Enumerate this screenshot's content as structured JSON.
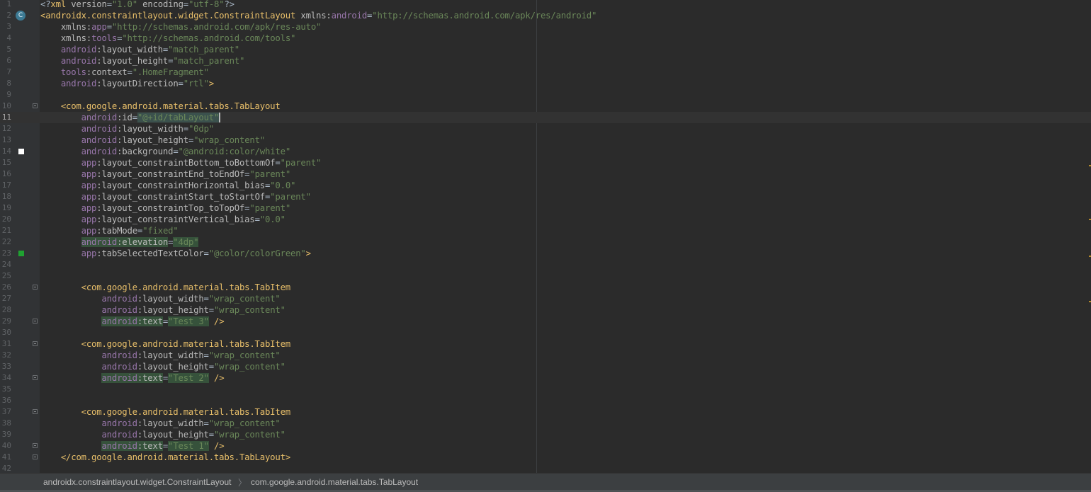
{
  "editor": {
    "current_line": 11,
    "lines": [
      {
        "n": "1",
        "tokens": [
          [
            "t",
            "<?"
          ],
          [
            "tag",
            "xml "
          ],
          [
            "attr",
            "version"
          ],
          [
            "t",
            "="
          ],
          [
            "val",
            "\"1.0\""
          ],
          [
            "t",
            " "
          ],
          [
            "attr",
            "encoding"
          ],
          [
            "t",
            "="
          ],
          [
            "val",
            "\"utf-8\""
          ],
          [
            "t",
            "?>"
          ]
        ]
      },
      {
        "n": "2",
        "marker": "class-icon",
        "marker_label": "C",
        "tokens": [
          [
            "tag",
            "<androidx.constraintlayout.widget.ConstraintLayout "
          ],
          [
            "attr",
            "xmlns:"
          ],
          [
            "ns",
            "android"
          ],
          [
            "t",
            "="
          ],
          [
            "val",
            "\"http://schemas.android.com/apk/res/android\""
          ]
        ]
      },
      {
        "n": "3",
        "tokens": [
          [
            "t",
            "    "
          ],
          [
            "attr",
            "xmlns:"
          ],
          [
            "ns",
            "app"
          ],
          [
            "t",
            "="
          ],
          [
            "val",
            "\"http://schemas.android.com/apk/res-auto\""
          ]
        ]
      },
      {
        "n": "4",
        "tokens": [
          [
            "t",
            "    "
          ],
          [
            "attr",
            "xmlns:"
          ],
          [
            "ns",
            "tools"
          ],
          [
            "t",
            "="
          ],
          [
            "val",
            "\"http://schemas.android.com/tools\""
          ]
        ]
      },
      {
        "n": "5",
        "tokens": [
          [
            "t",
            "    "
          ],
          [
            "ns",
            "android"
          ],
          [
            "attr",
            ":layout_width"
          ],
          [
            "t",
            "="
          ],
          [
            "val",
            "\"match_parent\""
          ]
        ]
      },
      {
        "n": "6",
        "tokens": [
          [
            "t",
            "    "
          ],
          [
            "ns",
            "android"
          ],
          [
            "attr",
            ":layout_height"
          ],
          [
            "t",
            "="
          ],
          [
            "val",
            "\"match_parent\""
          ]
        ]
      },
      {
        "n": "7",
        "tokens": [
          [
            "t",
            "    "
          ],
          [
            "ns",
            "tools"
          ],
          [
            "attr",
            ":context"
          ],
          [
            "t",
            "="
          ],
          [
            "val",
            "\".HomeFragment\""
          ]
        ]
      },
      {
        "n": "8",
        "tokens": [
          [
            "t",
            "    "
          ],
          [
            "ns",
            "android"
          ],
          [
            "attr",
            ":layoutDirection"
          ],
          [
            "t",
            "="
          ],
          [
            "val",
            "\"rtl\""
          ],
          [
            "tag",
            ">"
          ]
        ]
      },
      {
        "n": "9",
        "tokens": []
      },
      {
        "n": "10",
        "fold": true,
        "tokens": [
          [
            "t",
            "    "
          ],
          [
            "tag",
            "<com.google.android.material.tabs.TabLayout"
          ]
        ]
      },
      {
        "n": "11",
        "tokens": [
          [
            "t",
            "        "
          ],
          [
            "ns",
            "android"
          ],
          [
            "attr",
            ":id"
          ],
          [
            "t",
            "="
          ],
          [
            "valhl",
            "\"@+id/tabLayout\""
          ]
        ]
      },
      {
        "n": "12",
        "tokens": [
          [
            "t",
            "        "
          ],
          [
            "ns",
            "android"
          ],
          [
            "attr",
            ":layout_width"
          ],
          [
            "t",
            "="
          ],
          [
            "val",
            "\"0dp\""
          ]
        ]
      },
      {
        "n": "13",
        "tokens": [
          [
            "t",
            "        "
          ],
          [
            "ns",
            "android"
          ],
          [
            "attr",
            ":layout_height"
          ],
          [
            "t",
            "="
          ],
          [
            "val",
            "\"wrap_content\""
          ]
        ]
      },
      {
        "n": "14",
        "marker": "swatch",
        "swatch_color": "#ffffff",
        "tokens": [
          [
            "t",
            "        "
          ],
          [
            "ns",
            "android"
          ],
          [
            "attr",
            ":background"
          ],
          [
            "t",
            "="
          ],
          [
            "val",
            "\"@android:color/white\""
          ]
        ]
      },
      {
        "n": "15",
        "tokens": [
          [
            "t",
            "        "
          ],
          [
            "ns",
            "app"
          ],
          [
            "attr",
            ":layout_constraintBottom_toBottomOf"
          ],
          [
            "t",
            "="
          ],
          [
            "val",
            "\"parent\""
          ]
        ]
      },
      {
        "n": "16",
        "tokens": [
          [
            "t",
            "        "
          ],
          [
            "ns",
            "app"
          ],
          [
            "attr",
            ":layout_constraintEnd_toEndOf"
          ],
          [
            "t",
            "="
          ],
          [
            "val",
            "\"parent\""
          ]
        ]
      },
      {
        "n": "17",
        "tokens": [
          [
            "t",
            "        "
          ],
          [
            "ns",
            "app"
          ],
          [
            "attr",
            ":layout_constraintHorizontal_bias"
          ],
          [
            "t",
            "="
          ],
          [
            "val",
            "\"0.0\""
          ]
        ]
      },
      {
        "n": "18",
        "tokens": [
          [
            "t",
            "        "
          ],
          [
            "ns",
            "app"
          ],
          [
            "attr",
            ":layout_constraintStart_toStartOf"
          ],
          [
            "t",
            "="
          ],
          [
            "val",
            "\"parent\""
          ]
        ]
      },
      {
        "n": "19",
        "tokens": [
          [
            "t",
            "        "
          ],
          [
            "ns",
            "app"
          ],
          [
            "attr",
            ":layout_constraintTop_toTopOf"
          ],
          [
            "t",
            "="
          ],
          [
            "val",
            "\"parent\""
          ]
        ]
      },
      {
        "n": "20",
        "tokens": [
          [
            "t",
            "        "
          ],
          [
            "ns",
            "app"
          ],
          [
            "attr",
            ":layout_constraintVertical_bias"
          ],
          [
            "t",
            "="
          ],
          [
            "val",
            "\"0.0\""
          ]
        ]
      },
      {
        "n": "21",
        "tokens": [
          [
            "t",
            "        "
          ],
          [
            "ns",
            "app"
          ],
          [
            "attr",
            ":tabMode"
          ],
          [
            "t",
            "="
          ],
          [
            "val",
            "\"fixed\""
          ]
        ]
      },
      {
        "n": "22",
        "tokens": [
          [
            "t",
            "        "
          ],
          [
            "nshl",
            "android"
          ],
          [
            "attrhl",
            ":elevation"
          ],
          [
            "t",
            "="
          ],
          [
            "valhl2",
            "\"4dp\""
          ]
        ]
      },
      {
        "n": "23",
        "marker": "swatch",
        "swatch_color": "#1fa231",
        "tokens": [
          [
            "t",
            "        "
          ],
          [
            "ns",
            "app"
          ],
          [
            "attr",
            ":tabSelectedTextColor"
          ],
          [
            "t",
            "="
          ],
          [
            "val",
            "\"@color/colorGreen\""
          ],
          [
            "tag",
            ">"
          ]
        ]
      },
      {
        "n": "24",
        "tokens": []
      },
      {
        "n": "25",
        "tokens": []
      },
      {
        "n": "26",
        "fold": true,
        "tokens": [
          [
            "t",
            "        "
          ],
          [
            "tag",
            "<com.google.android.material.tabs.TabItem"
          ]
        ]
      },
      {
        "n": "27",
        "tokens": [
          [
            "t",
            "            "
          ],
          [
            "ns",
            "android"
          ],
          [
            "attr",
            ":layout_width"
          ],
          [
            "t",
            "="
          ],
          [
            "val",
            "\"wrap_content\""
          ]
        ]
      },
      {
        "n": "28",
        "tokens": [
          [
            "t",
            "            "
          ],
          [
            "ns",
            "android"
          ],
          [
            "attr",
            ":layout_height"
          ],
          [
            "t",
            "="
          ],
          [
            "val",
            "\"wrap_content\""
          ]
        ]
      },
      {
        "n": "29",
        "fold": true,
        "tokens": [
          [
            "t",
            "            "
          ],
          [
            "nshl",
            "android"
          ],
          [
            "attrhl",
            ":text"
          ],
          [
            "t",
            "="
          ],
          [
            "valhl2",
            "\"Test 3\""
          ],
          [
            "tag",
            " />"
          ]
        ]
      },
      {
        "n": "30",
        "tokens": []
      },
      {
        "n": "31",
        "fold": true,
        "tokens": [
          [
            "t",
            "        "
          ],
          [
            "tag",
            "<com.google.android.material.tabs.TabItem"
          ]
        ]
      },
      {
        "n": "32",
        "tokens": [
          [
            "t",
            "            "
          ],
          [
            "ns",
            "android"
          ],
          [
            "attr",
            ":layout_width"
          ],
          [
            "t",
            "="
          ],
          [
            "val",
            "\"wrap_content\""
          ]
        ]
      },
      {
        "n": "33",
        "tokens": [
          [
            "t",
            "            "
          ],
          [
            "ns",
            "android"
          ],
          [
            "attr",
            ":layout_height"
          ],
          [
            "t",
            "="
          ],
          [
            "val",
            "\"wrap_content\""
          ]
        ]
      },
      {
        "n": "34",
        "fold": true,
        "tokens": [
          [
            "t",
            "            "
          ],
          [
            "nshl",
            "android"
          ],
          [
            "attrhl",
            ":text"
          ],
          [
            "t",
            "="
          ],
          [
            "valhl2",
            "\"Test 2\""
          ],
          [
            "tag",
            " />"
          ]
        ]
      },
      {
        "n": "35",
        "tokens": []
      },
      {
        "n": "36",
        "tokens": []
      },
      {
        "n": "37",
        "fold": true,
        "tokens": [
          [
            "t",
            "        "
          ],
          [
            "tag",
            "<com.google.android.material.tabs.TabItem"
          ]
        ]
      },
      {
        "n": "38",
        "tokens": [
          [
            "t",
            "            "
          ],
          [
            "ns",
            "android"
          ],
          [
            "attr",
            ":layout_width"
          ],
          [
            "t",
            "="
          ],
          [
            "val",
            "\"wrap_content\""
          ]
        ]
      },
      {
        "n": "39",
        "tokens": [
          [
            "t",
            "            "
          ],
          [
            "ns",
            "android"
          ],
          [
            "attr",
            ":layout_height"
          ],
          [
            "t",
            "="
          ],
          [
            "val",
            "\"wrap_content\""
          ]
        ]
      },
      {
        "n": "40",
        "fold": true,
        "tokens": [
          [
            "t",
            "            "
          ],
          [
            "nshl",
            "android"
          ],
          [
            "attrhl",
            ":text"
          ],
          [
            "t",
            "="
          ],
          [
            "valhl2",
            "\"Test 1\""
          ],
          [
            "tag",
            " />"
          ]
        ]
      },
      {
        "n": "41",
        "fold": true,
        "tokens": [
          [
            "t",
            "    "
          ],
          [
            "tag",
            "</com.google.android.material.tabs.TabLayout>"
          ]
        ]
      },
      {
        "n": "42",
        "tokens": []
      }
    ]
  },
  "breadcrumb": {
    "items": [
      "androidx.constraintlayout.widget.ConstraintLayout",
      "com.google.android.material.tabs.TabLayout"
    ],
    "separator": "〉"
  }
}
